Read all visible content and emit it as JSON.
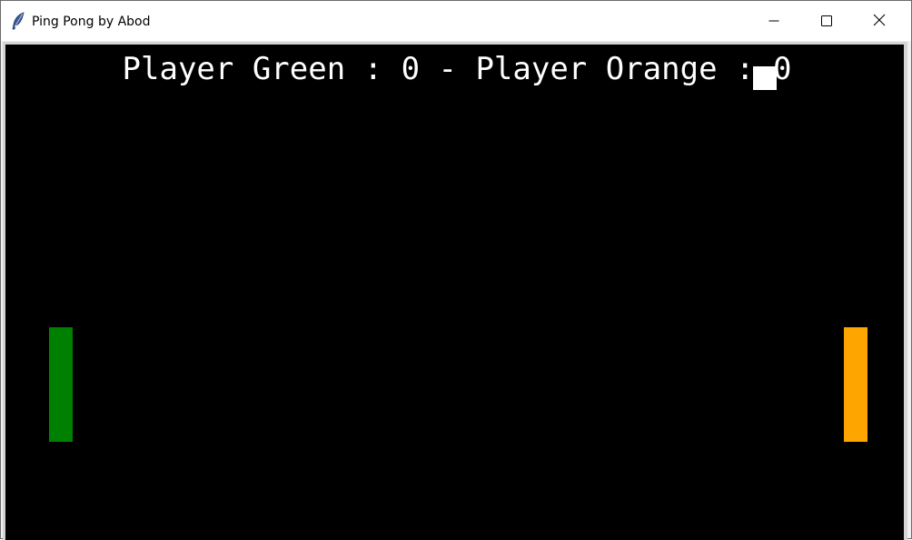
{
  "window": {
    "title": "Ping Pong by Abod",
    "icon": "feather-icon",
    "controls": {
      "minimize_icon": "minimize-icon",
      "maximize_icon": "maximize-icon",
      "close_icon": "close-icon"
    }
  },
  "game": {
    "background": "#000000",
    "score_text": "Player Green : 0 - Player Orange : 0",
    "left_player": {
      "name": "Player Green",
      "score": 0,
      "color": "#008000"
    },
    "right_player": {
      "name": "Player Orange",
      "score": 0,
      "color": "#ffa500"
    },
    "ball_color": "#ffffff"
  }
}
